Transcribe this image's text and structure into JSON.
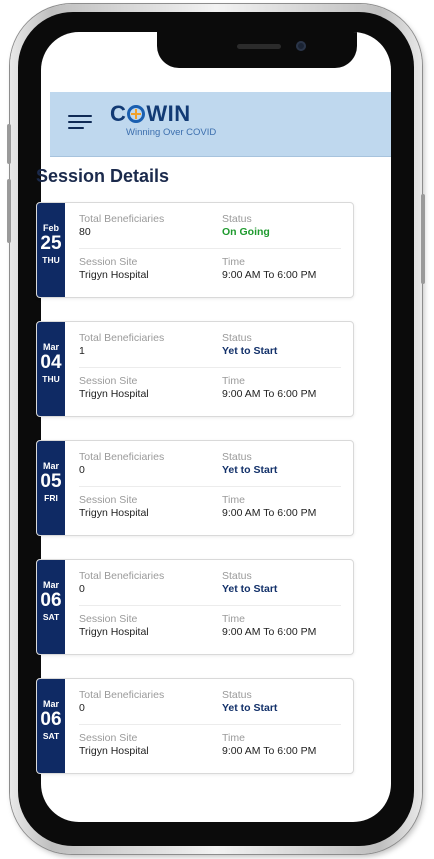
{
  "app": {
    "logo_part1": "C",
    "logo_part2": "WIN",
    "tagline": "Winning Over COVID"
  },
  "page": {
    "title": "Session Details"
  },
  "labels": {
    "total_beneficiaries": "Total Beneficiaries",
    "status": "Status",
    "session_site": "Session Site",
    "time": "Time"
  },
  "sessions": [
    {
      "month": "Feb",
      "day": "25",
      "weekday": "THU",
      "total_beneficiaries": "80",
      "status": "On Going",
      "session_site": "Trigyn Hospital",
      "time": "9:00 AM To 6:00 PM"
    },
    {
      "month": "Mar",
      "day": "04",
      "weekday": "THU",
      "total_beneficiaries": "1",
      "status": "Yet to Start",
      "session_site": "Trigyn Hospital",
      "time": "9:00 AM To 6:00 PM"
    },
    {
      "month": "Mar",
      "day": "05",
      "weekday": "FRI",
      "total_beneficiaries": "0",
      "status": "Yet to Start",
      "session_site": "Trigyn Hospital",
      "time": "9:00 AM To 6:00 PM"
    },
    {
      "month": "Mar",
      "day": "06",
      "weekday": "SAT",
      "total_beneficiaries": "0",
      "status": "Yet to Start",
      "session_site": "Trigyn Hospital",
      "time": "9:00 AM To 6:00 PM"
    },
    {
      "month": "Mar",
      "day": "06",
      "weekday": "SAT",
      "total_beneficiaries": "0",
      "status": "Yet to Start",
      "session_site": "Trigyn Hospital",
      "time": "9:00 AM To 6:00 PM"
    }
  ],
  "colors": {
    "header_bg": "#bfd8ee",
    "date_block": "#0f2a64",
    "status_ongoing": "#1e9a2e",
    "status_yet_to_start": "#13316a",
    "logo_accent": "#f0a12a"
  },
  "icons": {
    "menu": "hamburger-menu-icon",
    "logo_o": "plus-in-circle-icon"
  }
}
